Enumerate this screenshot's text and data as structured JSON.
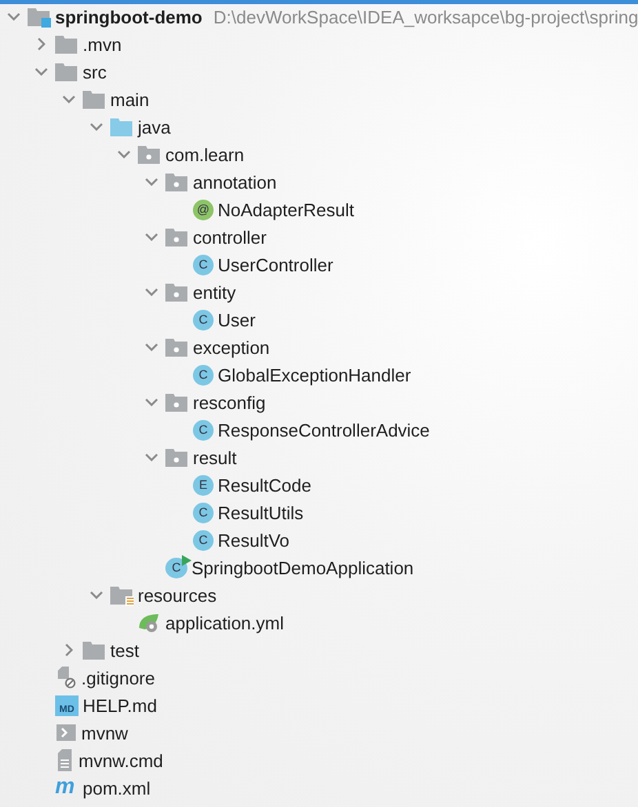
{
  "project_tree": [
    {
      "name": "springboot-demo",
      "path": "D:\\devWorkSpace\\IDEA_worksapce\\bg-project\\spring",
      "kind": "module",
      "expanded": true,
      "children": [
        {
          "name": ".mvn",
          "kind": "folder",
          "expanded": false
        },
        {
          "name": "src",
          "kind": "folder",
          "expanded": true,
          "children": [
            {
              "name": "main",
              "kind": "folder",
              "expanded": true,
              "children": [
                {
                  "name": "java",
                  "kind": "source-folder",
                  "expanded": true,
                  "children": [
                    {
                      "name": "com.learn",
                      "kind": "package",
                      "expanded": true,
                      "children": [
                        {
                          "name": "annotation",
                          "kind": "package",
                          "expanded": true,
                          "children": [
                            {
                              "name": "NoAdapterResult",
                              "kind": "annotation",
                              "letter": "@"
                            }
                          ]
                        },
                        {
                          "name": "controller",
                          "kind": "package",
                          "expanded": true,
                          "children": [
                            {
                              "name": "UserController",
                              "kind": "class",
                              "letter": "C"
                            }
                          ]
                        },
                        {
                          "name": "entity",
                          "kind": "package",
                          "expanded": true,
                          "children": [
                            {
                              "name": "User",
                              "kind": "class",
                              "letter": "C"
                            }
                          ]
                        },
                        {
                          "name": "exception",
                          "kind": "package",
                          "expanded": true,
                          "children": [
                            {
                              "name": "GlobalExceptionHandler",
                              "kind": "class",
                              "letter": "C"
                            }
                          ]
                        },
                        {
                          "name": "resconfig",
                          "kind": "package",
                          "expanded": true,
                          "children": [
                            {
                              "name": "ResponseControllerAdvice",
                              "kind": "class",
                              "letter": "C"
                            }
                          ]
                        },
                        {
                          "name": "result",
                          "kind": "package",
                          "expanded": true,
                          "children": [
                            {
                              "name": "ResultCode",
                              "kind": "enum",
                              "letter": "E"
                            },
                            {
                              "name": "ResultUtils",
                              "kind": "class",
                              "letter": "C"
                            },
                            {
                              "name": "ResultVo",
                              "kind": "class",
                              "letter": "C"
                            }
                          ]
                        },
                        {
                          "name": "SpringbootDemoApplication",
                          "kind": "spring-app",
                          "letter": "C"
                        }
                      ]
                    }
                  ]
                },
                {
                  "name": "resources",
                  "kind": "resources-folder",
                  "expanded": true,
                  "children": [
                    {
                      "name": "application.yml",
                      "kind": "spring-config"
                    }
                  ]
                }
              ]
            },
            {
              "name": "test",
              "kind": "folder",
              "expanded": false
            }
          ]
        },
        {
          "name": ".gitignore",
          "kind": "ignore-file"
        },
        {
          "name": "HELP.md",
          "kind": "markdown",
          "letter": "MD"
        },
        {
          "name": "mvnw",
          "kind": "shell"
        },
        {
          "name": "mvnw.cmd",
          "kind": "text-file"
        },
        {
          "name": "pom.xml",
          "kind": "maven",
          "letter": "m"
        }
      ]
    }
  ]
}
